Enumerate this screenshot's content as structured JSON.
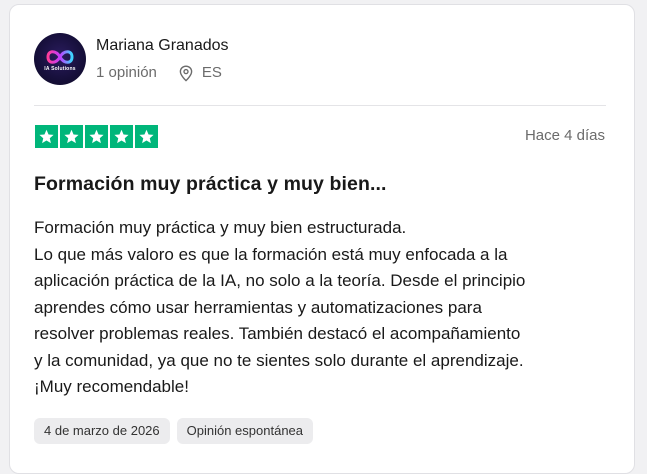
{
  "colors": {
    "star_green": "#00b67a",
    "card_background": "#ffffff",
    "muted_text": "#6b6b6b"
  },
  "reviewer": {
    "avatar_text": "IA Solutions",
    "name": "Mariana Granados",
    "review_count": "1 opinión",
    "location_icon": "map-pin-icon",
    "country": "ES"
  },
  "review": {
    "rating": 5,
    "rating_max": 5,
    "date_ago": "Hace 4 días",
    "title": "Formación muy práctica y muy bien...",
    "body_lines": [
      "Formación muy práctica y muy bien estructurada.",
      "Lo que más valoro es que la formación está muy enfocada a la",
      "aplicación práctica de la IA, no solo a la teoría. Desde el principio",
      "aprendes cómo usar herramientas y automatizaciones para",
      "resolver problemas reales. También destacó el acompañamiento",
      "y la comunidad, ya que no te sientes solo durante el aprendizaje.",
      "¡Muy recomendable!"
    ],
    "tags": [
      "4 de marzo de 2026",
      "Opinión espontánea"
    ]
  }
}
